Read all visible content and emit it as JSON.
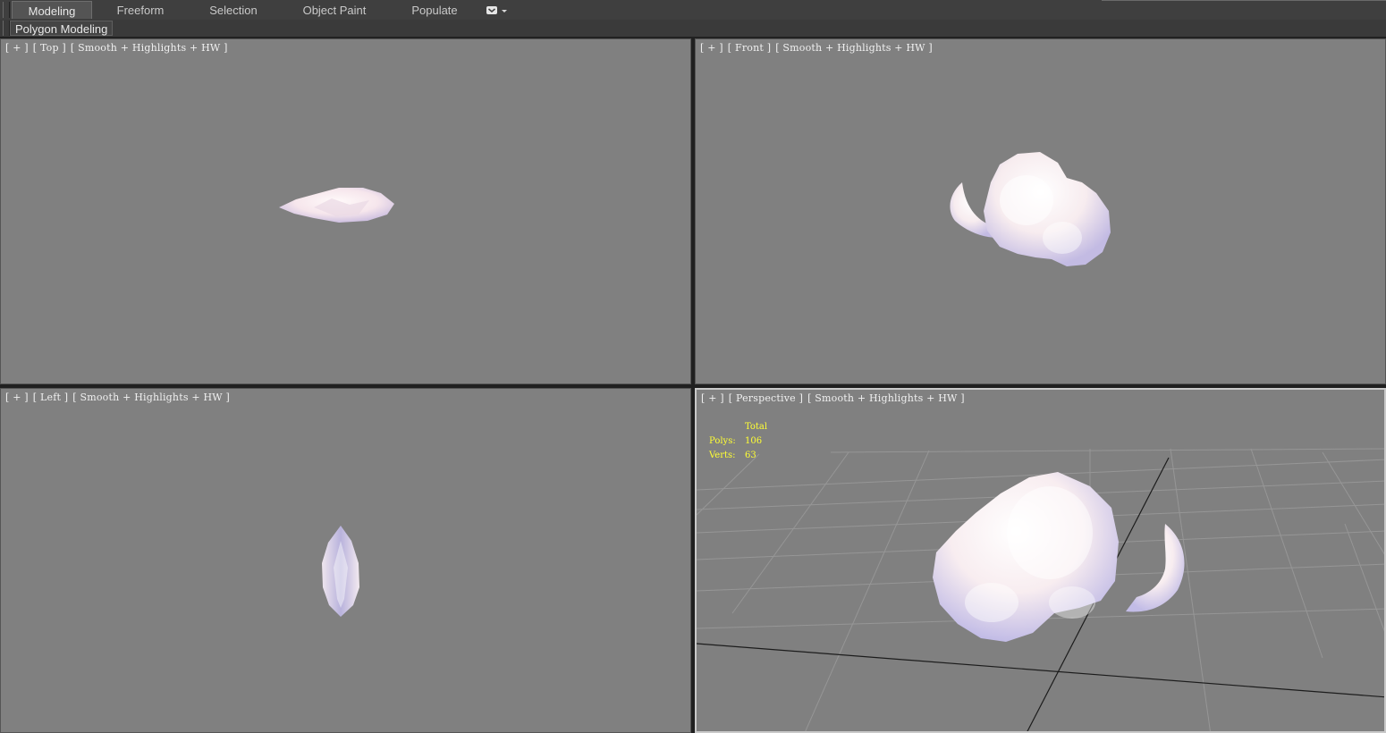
{
  "ribbon": {
    "tabs": [
      {
        "label": "Modeling",
        "active": true
      },
      {
        "label": "Freeform",
        "active": false
      },
      {
        "label": "Selection",
        "active": false
      },
      {
        "label": "Object Paint",
        "active": false
      },
      {
        "label": "Populate",
        "active": false
      }
    ],
    "dropdown_icon": "ribbon-options-icon"
  },
  "subbar": {
    "panel_label": "Polygon Modeling"
  },
  "viewports": {
    "top": {
      "plus": "[ + ]",
      "name": "[ Top ]",
      "shading": "[ Smooth + Highlights + HW ]"
    },
    "front": {
      "plus": "[ + ]",
      "name": "[ Front ]",
      "shading": "[ Smooth + Highlights + HW ]"
    },
    "left": {
      "plus": "[ + ]",
      "name": "[ Left ]",
      "shading": "[ Smooth + Highlights + HW ]"
    },
    "perspective": {
      "plus": "[ + ]",
      "name": "[ Perspective ]",
      "shading": "[ Smooth + Highlights + HW ]"
    }
  },
  "stats": {
    "header": "Total",
    "polys_label": "Polys:",
    "polys_value": "106",
    "verts_label": "Verts:",
    "verts_value": "63"
  },
  "colors": {
    "viewport_bg": "#808080",
    "stats_text": "#ffff33",
    "cloud_light": "#fff7f7",
    "cloud_shadow": "#c9c2e8"
  }
}
